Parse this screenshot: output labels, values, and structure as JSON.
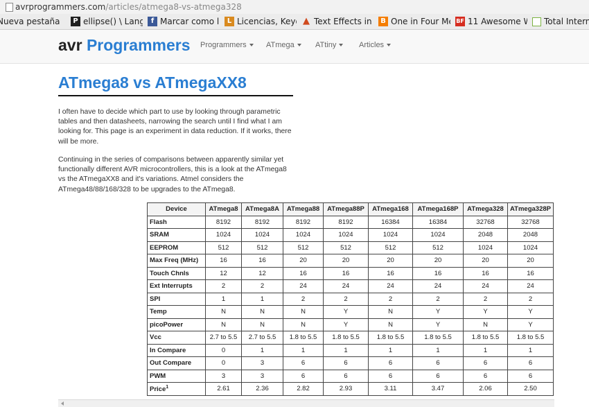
{
  "browser": {
    "url_host": "avrprogrammers.com",
    "url_path": "/articles/atmega8-vs-atmega328"
  },
  "bookmarks": [
    {
      "label": "Nueva pestaña",
      "icon": "page-icon",
      "color": "#ececec"
    },
    {
      "label": "ellipse() \\ Lang",
      "icon": "processing-icon",
      "color": "#1f1f1f"
    },
    {
      "label": "Marcar como le",
      "icon": "facebook-icon",
      "color": "#3b5998"
    },
    {
      "label": "Licencias, Keyg",
      "icon": "bookmark-icon",
      "color": "#d98a1f"
    },
    {
      "label": "Text Effects in",
      "icon": "flame-icon",
      "color": "#d04a1e"
    },
    {
      "label": "One in Four Me",
      "icon": "blogger-icon",
      "color": "#f57d00"
    },
    {
      "label": "11 Awesome W",
      "icon": "bf-icon",
      "color": "#d62d20"
    },
    {
      "label": "Total Intern",
      "icon": "frame-icon",
      "color": "#7cb342"
    }
  ],
  "site": {
    "brand_part1": "avr",
    "brand_part2": "Programmers",
    "nav": [
      "Programmers",
      "ATmega",
      "ATtiny",
      "Articles"
    ]
  },
  "article": {
    "title": "ATmega8 vs ATmegaXX8",
    "paragraphs": [
      "I often have to decide which part to use by looking through parametric tables and then datasheets, narrowing the search until I find what I am looking for. This page is an experiment in data reduction. If it works, there will be more.",
      "Continuing in the series of comparisons between apparently similar yet functionally different AVR microcontrollers, this is a look at the ATmega8 vs the ATmegaXX8 and it's variations. Atmel considers the ATmega48/88/168/328 to be upgrades to the ATmega8."
    ]
  },
  "table": {
    "headers": [
      "Device",
      "ATmega8",
      "ATmega8A",
      "ATmega88",
      "ATmega88P",
      "ATmega168",
      "ATmega168P",
      "ATmega328",
      "ATmega328P"
    ],
    "rows": [
      {
        "label": "Flash",
        "values": [
          "8192",
          "8192",
          "8192",
          "8192",
          "16384",
          "16384",
          "32768",
          "32768"
        ]
      },
      {
        "label": "SRAM",
        "values": [
          "1024",
          "1024",
          "1024",
          "1024",
          "1024",
          "1024",
          "2048",
          "2048"
        ]
      },
      {
        "label": "EEPROM",
        "values": [
          "512",
          "512",
          "512",
          "512",
          "512",
          "512",
          "1024",
          "1024"
        ]
      },
      {
        "label": "Max Freq (MHz)",
        "values": [
          "16",
          "16",
          "20",
          "20",
          "20",
          "20",
          "20",
          "20"
        ]
      },
      {
        "label": "Touch Chnls",
        "values": [
          "12",
          "12",
          "16",
          "16",
          "16",
          "16",
          "16",
          "16"
        ]
      },
      {
        "label": "Ext Interrupts",
        "values": [
          "2",
          "2",
          "24",
          "24",
          "24",
          "24",
          "24",
          "24"
        ]
      },
      {
        "label": "SPI",
        "values": [
          "1",
          "1",
          "2",
          "2",
          "2",
          "2",
          "2",
          "2"
        ]
      },
      {
        "label": "Temp",
        "values": [
          "N",
          "N",
          "N",
          "Y",
          "N",
          "Y",
          "Y",
          "Y"
        ]
      },
      {
        "label": "picoPower",
        "values": [
          "N",
          "N",
          "N",
          "Y",
          "N",
          "Y",
          "N",
          "Y"
        ]
      },
      {
        "label": "Vcc",
        "values": [
          "2.7 to 5.5",
          "2.7 to 5.5",
          "1.8 to 5.5",
          "1.8 to 5.5",
          "1.8 to 5.5",
          "1.8 to 5.5",
          "1.8 to 5.5",
          "1.8 to 5.5"
        ]
      },
      {
        "label": "In Compare",
        "values": [
          "0",
          "1",
          "1",
          "1",
          "1",
          "1",
          "1",
          "1"
        ]
      },
      {
        "label": "Out Compare",
        "values": [
          "0",
          "3",
          "6",
          "6",
          "6",
          "6",
          "6",
          "6"
        ]
      },
      {
        "label": "PWM",
        "values": [
          "3",
          "3",
          "6",
          "6",
          "6",
          "6",
          "6",
          "6"
        ]
      },
      {
        "label": "Price",
        "sup": "1",
        "values": [
          "2.61",
          "2.36",
          "2.82",
          "2.93",
          "3.11",
          "3.47",
          "2.06",
          "2.50"
        ]
      }
    ]
  },
  "colors": {
    "brand_blue": "#2a7ed2",
    "text": "#333333"
  }
}
